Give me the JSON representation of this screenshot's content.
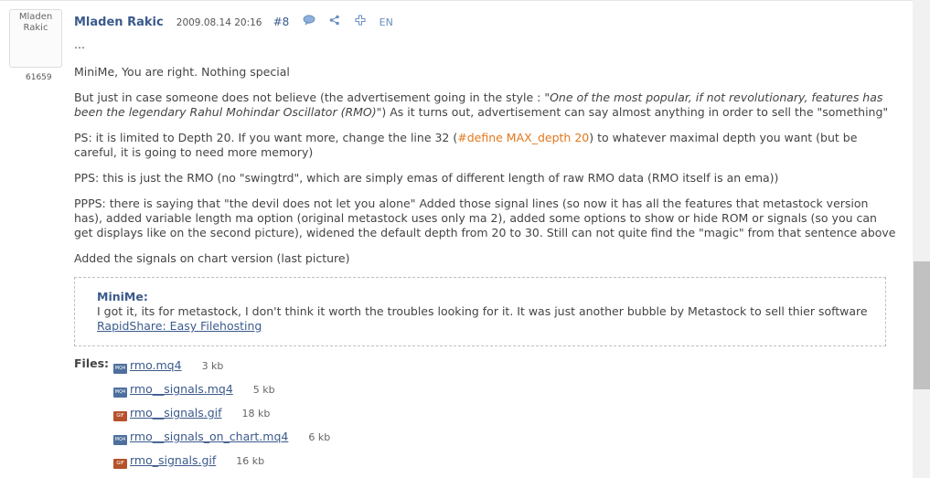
{
  "post": {
    "avatar_name_line1": "Mladen",
    "avatar_name_line2": "Rakic",
    "post_count": "61659",
    "author": "Mladen Rakic",
    "date": "2009.08.14 20:16",
    "number": "#8",
    "language": "EN",
    "icons": [
      "comment-icon",
      "share-icon",
      "plus-icon"
    ]
  },
  "content": {
    "ellipsis": "...",
    "p1": "MiniMe, You are right. Nothing special",
    "p2_a": "But just in case someone does not believe (the advertisement going in the style : \"",
    "p2_b": "One of the most popular, if not revolutionary, features has been the legendary Rahul Mohindar Oscillator (RMO)",
    "p2_c": "\") As it turns out, advertisement can say almost anything in order to sell the \"something\"",
    "p3_a": "PS: it is limited to Depth 20. If you want more, change the line 32 (",
    "p3_code": "#define MAX_depth 20",
    "p3_c": ") to whatever maximal depth you want (but be careful, it is going to need more memory)",
    "p4": "PPS: this is just the RMO (no \"swingtrd\", which are simply emas of different length of raw RMO data (RMO itself is an ema))",
    "p5": "PPPS: there is saying that \"the devil does not let you alone\" Added those signal lines (so now it has all the features that metastock version has), added variable length ma option (original metastock uses only ma 2), added some options to show or hide ROM or signals (so you can get displays like on the second picture), widened the default depth from 20 to 30. Still can not quite find the \"magic\" from that sentence above",
    "p6": "Added the signals on chart version (last picture)"
  },
  "quote": {
    "author": "MiniMe:",
    "text": "I got it, its for metastock, I don't think it worth the troubles looking for it. It was just another bubble by Metastock to sell thier software ",
    "link": "RapidShare: Easy Filehosting"
  },
  "files": {
    "label": "Files:",
    "items": [
      {
        "name": "rmo.mq4",
        "size": "3 kb",
        "icon": "mq4-file-icon",
        "icon_text": "MQ4"
      },
      {
        "name": "rmo__signals.mq4",
        "size": "5 kb",
        "icon": "mq4-file-icon",
        "icon_text": "MQ4"
      },
      {
        "name": "rmo__signals.gif",
        "size": "18 kb",
        "icon": "gif-file-icon",
        "icon_text": "GIF"
      },
      {
        "name": "rmo__signals_on_chart.mq4",
        "size": "6 kb",
        "icon": "mq4-file-icon",
        "icon_text": "MQ4"
      },
      {
        "name": "rmo_signals.gif",
        "size": "16 kb",
        "icon": "gif-file-icon",
        "icon_text": "GIF"
      }
    ]
  }
}
